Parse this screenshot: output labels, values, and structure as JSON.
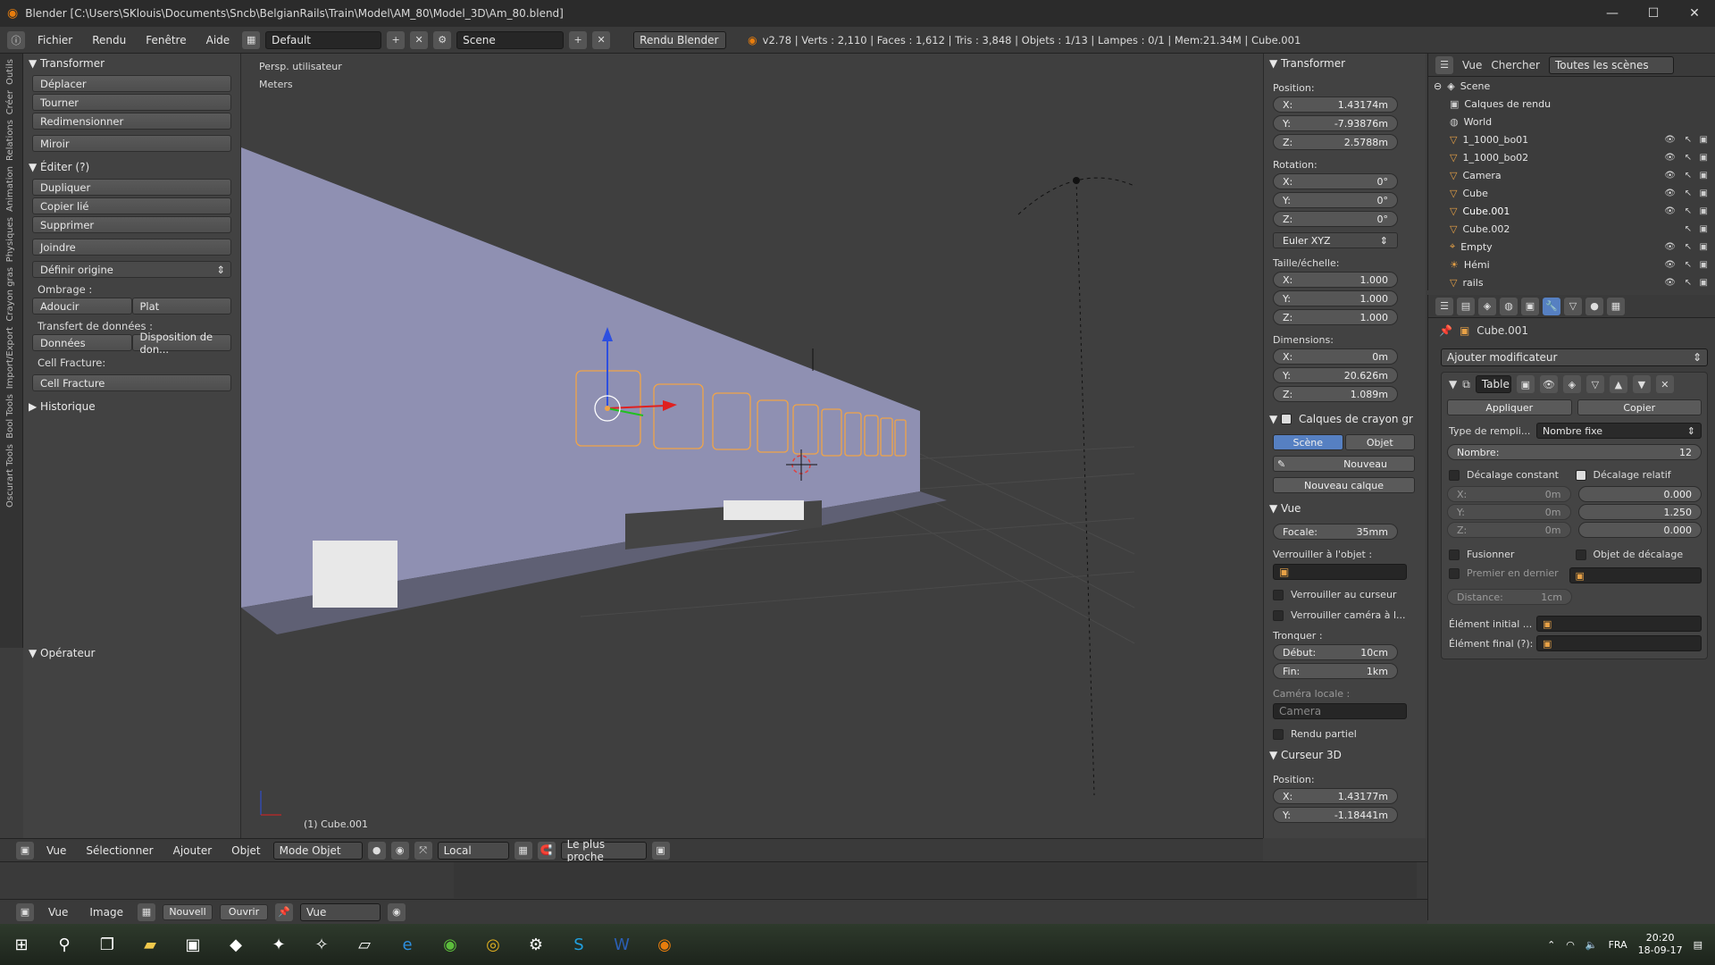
{
  "window": {
    "title": "Blender [C:\\Users\\SKlouis\\Documents\\Sncb\\BelgianRails\\Train\\Model\\AM_80\\Model_3D\\Am_80.blend]",
    "min": "—",
    "max": "☐",
    "close": "✕"
  },
  "infobar": {
    "menus": [
      "Fichier",
      "Rendu",
      "Fenêtre",
      "Aide"
    ],
    "layout": "Default",
    "scene": "Scene",
    "engine": "Rendu Blender",
    "stats": "v2.78 | Verts : 2,110 | Faces : 1,612 | Tris : 3,848 | Objets : 1/13 | Lampes : 0/1 | Mem:21.34M | Cube.001"
  },
  "left_tabs": [
    "Outils",
    "Créer",
    "Relations",
    "Animation",
    "Physiques",
    "Crayon gras",
    "Import/Export",
    "Bool Tools",
    "Oscurart Tools"
  ],
  "tools": {
    "transform_header": "Transformer",
    "transform": [
      "Déplacer",
      "Tourner",
      "Redimensionner",
      "Miroir"
    ],
    "edit_header": "Éditer (?)",
    "edit": [
      "Dupliquer",
      "Copier lié",
      "Supprimer",
      "Joindre"
    ],
    "set_origin": "Définir origine",
    "shading_label": "Ombrage :",
    "shading": [
      "Adoucir",
      "Plat"
    ],
    "transfer_label": "Transfert de données :",
    "transfer": [
      "Données",
      "Disposition de don..."
    ],
    "cell_label": "Cell Fracture:",
    "cell_btn": "Cell Fracture",
    "history": "Historique",
    "operator": "Opérateur"
  },
  "viewport": {
    "view_name": "Persp. utilisateur",
    "units": "Meters",
    "object_label": "(1) Cube.001"
  },
  "npanel": {
    "transform": "Transformer",
    "position_label": "Position:",
    "position": [
      {
        "axis": "X:",
        "value": "1.43174m"
      },
      {
        "axis": "Y:",
        "value": "-7.93876m"
      },
      {
        "axis": "Z:",
        "value": "2.5788m"
      }
    ],
    "rotation_label": "Rotation:",
    "rotation": [
      {
        "axis": "X:",
        "value": "0°"
      },
      {
        "axis": "Y:",
        "value": "0°"
      },
      {
        "axis": "Z:",
        "value": "0°"
      }
    ],
    "rotation_mode": "Euler XYZ",
    "scale_label": "Taille/échelle:",
    "scale": [
      {
        "axis": "X:",
        "value": "1.000"
      },
      {
        "axis": "Y:",
        "value": "1.000"
      },
      {
        "axis": "Z:",
        "value": "1.000"
      }
    ],
    "dims_label": "Dimensions:",
    "dims": [
      {
        "axis": "X:",
        "value": "0m"
      },
      {
        "axis": "Y:",
        "value": "20.626m"
      },
      {
        "axis": "Z:",
        "value": "1.089m"
      }
    ],
    "grease": "Calques de crayon gr",
    "grease_tabs": [
      "Scène",
      "Objet"
    ],
    "new": "Nouveau",
    "new_layer": "Nouveau calque",
    "view": "Vue",
    "focal_label": "Focale:",
    "focal": "35mm",
    "lock_obj": "Verrouiller à l'objet :",
    "lock_cursor": "Verrouiller au curseur",
    "lock_cam": "Verrouiller caméra à l...",
    "clip": "Tronquer :",
    "clip_start_label": "Début:",
    "clip_start": "10cm",
    "clip_end_label": "Fin:",
    "clip_end": "1km",
    "local_cam": "Caméra locale :",
    "camera": "Camera",
    "partial": "Rendu partiel",
    "cursor": "Curseur 3D",
    "cursor_pos_label": "Position:",
    "cursor_pos": [
      {
        "axis": "X:",
        "value": "1.43177m"
      },
      {
        "axis": "Y:",
        "value": "-1.18441m"
      }
    ]
  },
  "outliner": {
    "menus": [
      "Vue",
      "Chercher"
    ],
    "scope": "Toutes les scènes",
    "items": [
      "Scene",
      "Calques de rendu",
      "World",
      "1_1000_bo01",
      "1_1000_bo02",
      "Camera",
      "Cube",
      "Cube.001",
      "Cube.002",
      "Empty",
      "Hémi",
      "rails"
    ]
  },
  "props": {
    "object": "Cube.001",
    "add_mod": "Ajouter modificateur",
    "mod_name": "Table",
    "apply": "Appliquer",
    "copy": "Copier",
    "fit_label": "Type de rempli...",
    "fit": "Nombre fixe",
    "count_label": "Nombre:",
    "count": "12",
    "const": "Décalage constant",
    "rel": "Décalage relatif",
    "const_vals": [
      {
        "axis": "X:",
        "value": "0m"
      },
      {
        "axis": "Y:",
        "value": "0m"
      },
      {
        "axis": "Z:",
        "value": "0m"
      }
    ],
    "rel_vals": [
      "0.000",
      "1.250",
      "0.000"
    ],
    "merge": "Fusionner",
    "offset_obj": "Objet de décalage",
    "first_last": "Premier en dernier",
    "distance_label": "Distance:",
    "distance": "1cm",
    "start_cap": "Élément initial ...",
    "end_cap": "Élément final (?):"
  },
  "bottombar": {
    "menus": [
      "Vue",
      "Sélectionner",
      "Ajouter",
      "Objet"
    ],
    "mode": "Mode Objet",
    "pivot": "Local",
    "snap": "Le plus proche"
  },
  "imgbar": {
    "menus": [
      "Vue",
      "Image"
    ],
    "new": "Nouvell",
    "open": "Ouvrir",
    "view": "Vue"
  },
  "taskbar": {
    "lang": "FRA",
    "time": "20:20",
    "date": "18-09-17"
  },
  "colors": {
    "accent": "#5680c2",
    "selected": "#f1a447",
    "bg": "#3d3d3d"
  }
}
